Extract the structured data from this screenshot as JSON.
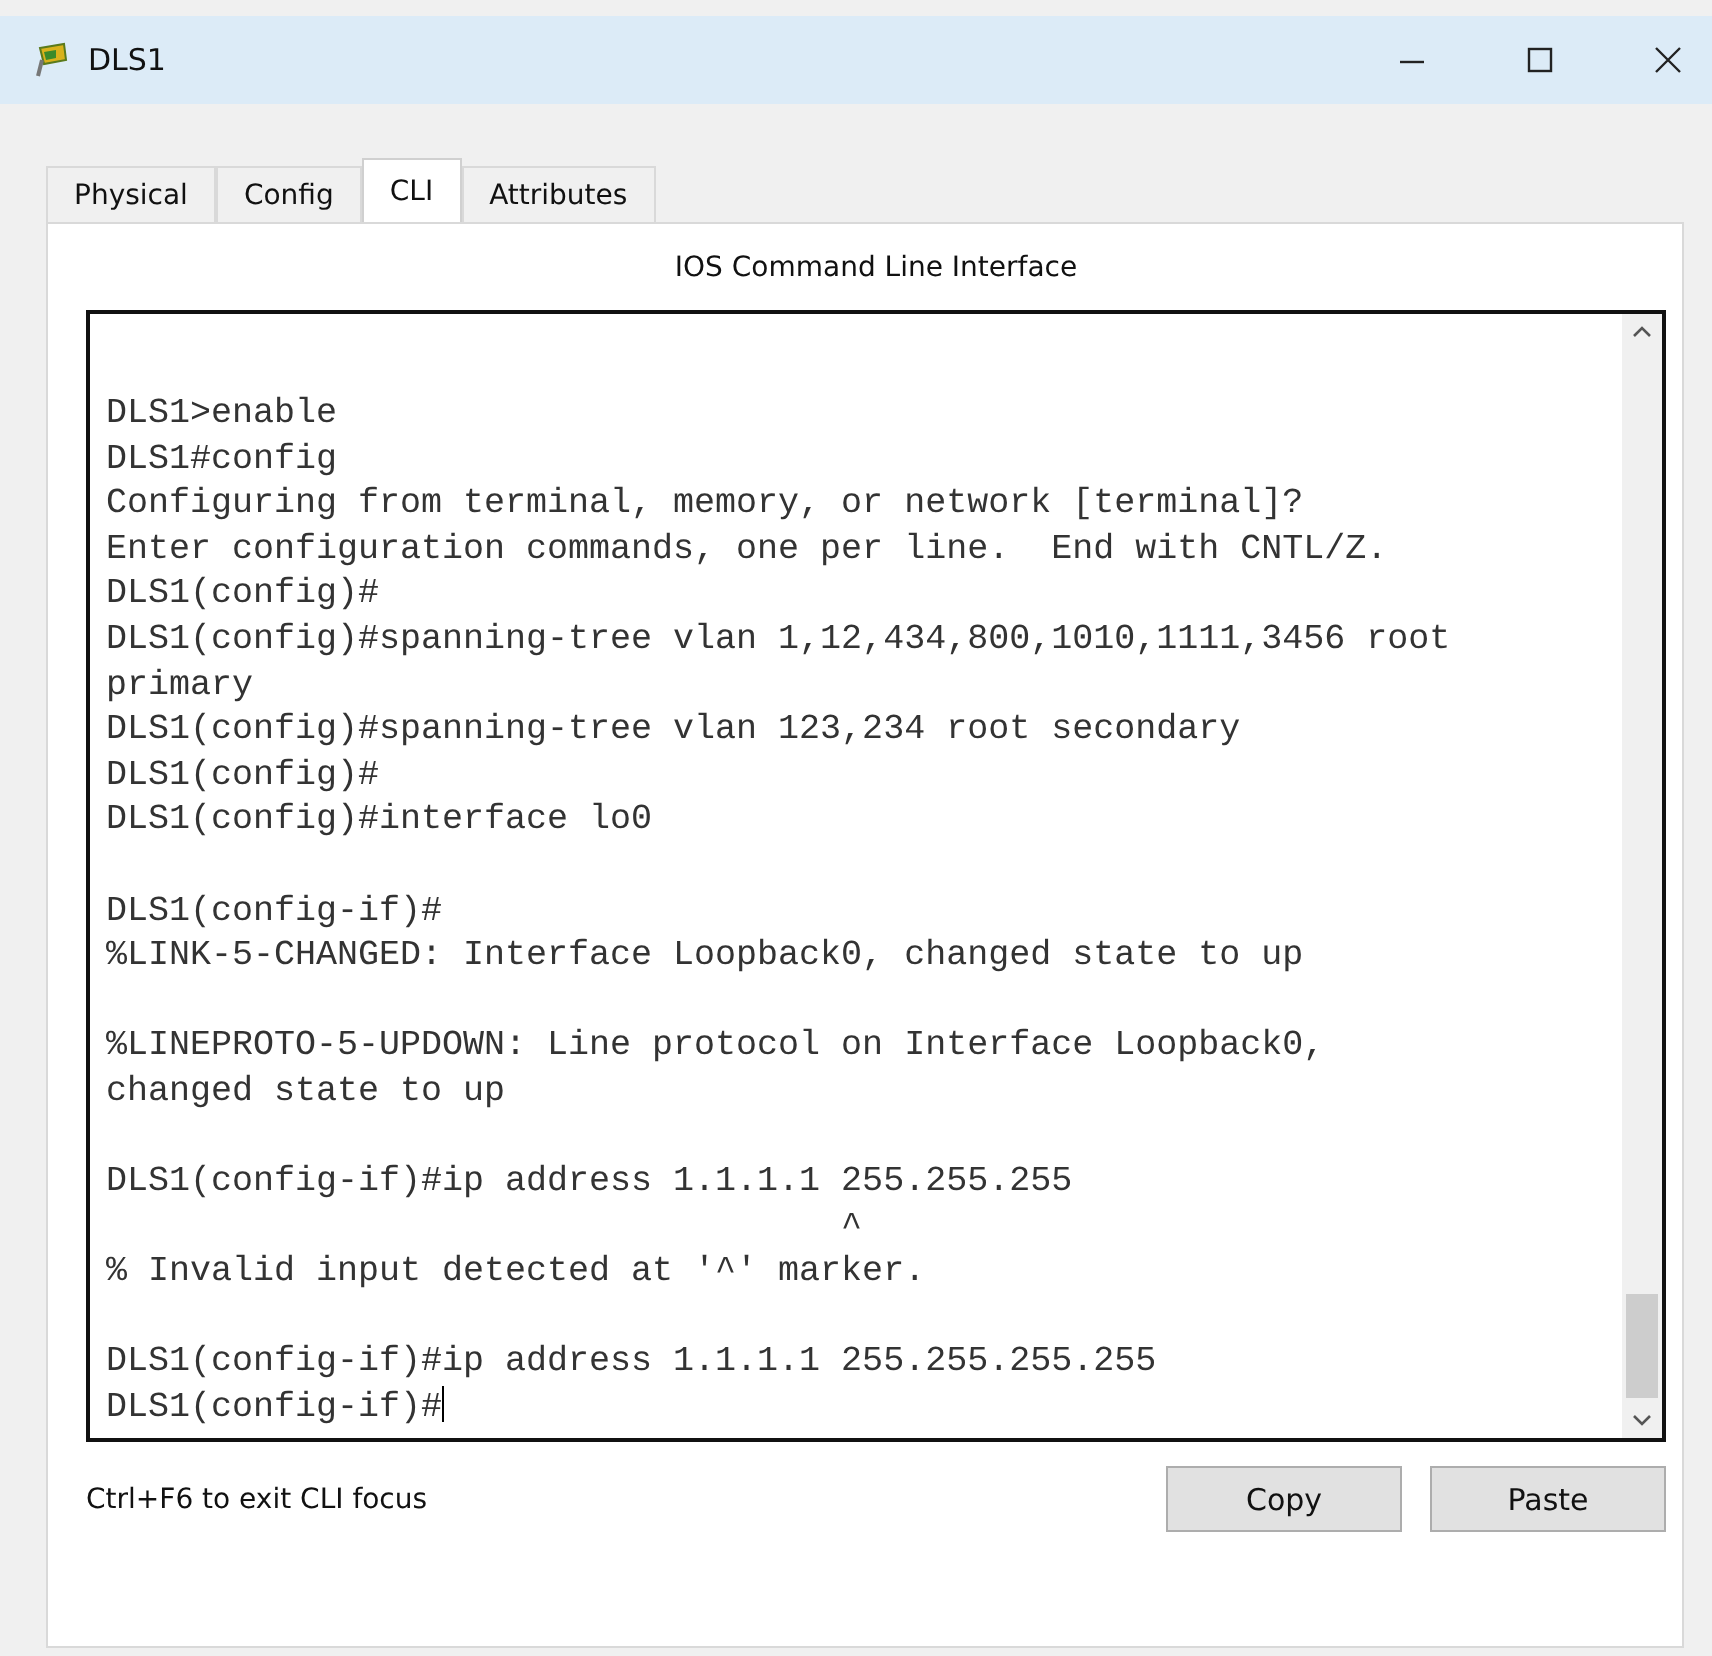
{
  "window": {
    "title": "DLS1"
  },
  "tabs": [
    {
      "label": "Physical",
      "selected": false
    },
    {
      "label": "Config",
      "selected": false
    },
    {
      "label": "CLI",
      "selected": true
    },
    {
      "label": "Attributes",
      "selected": false
    }
  ],
  "cli": {
    "heading": "IOS Command Line Interface",
    "blocks": [
      [
        "DLS1>enable",
        "DLS1#config",
        "Configuring from terminal, memory, or network [terminal]?",
        "Enter configuration commands, one per line.  End with CNTL/Z.",
        "DLS1(config)#",
        "DLS1(config)#spanning-tree vlan 1,12,434,800,1010,1111,3456 root",
        "primary",
        "DLS1(config)#spanning-tree vlan 123,234 root secondary",
        "DLS1(config)#",
        "DLS1(config)#interface lo0"
      ],
      [
        "DLS1(config-if)#",
        "%LINK-5-CHANGED: Interface Loopback0, changed state to up"
      ],
      [
        "%LINEPROTO-5-UPDOWN: Line protocol on Interface Loopback0,",
        "changed state to up"
      ],
      [
        "DLS1(config-if)#ip address 1.1.1.1 255.255.255",
        "                                   ^",
        "% Invalid input detected at '^' marker."
      ],
      [
        "DLS1(config-if)#ip address 1.1.1.1 255.255.255.255",
        "DLS1(config-if)#"
      ]
    ],
    "hint": "Ctrl+F6 to exit CLI focus",
    "buttons": [
      "Copy",
      "Paste"
    ]
  }
}
